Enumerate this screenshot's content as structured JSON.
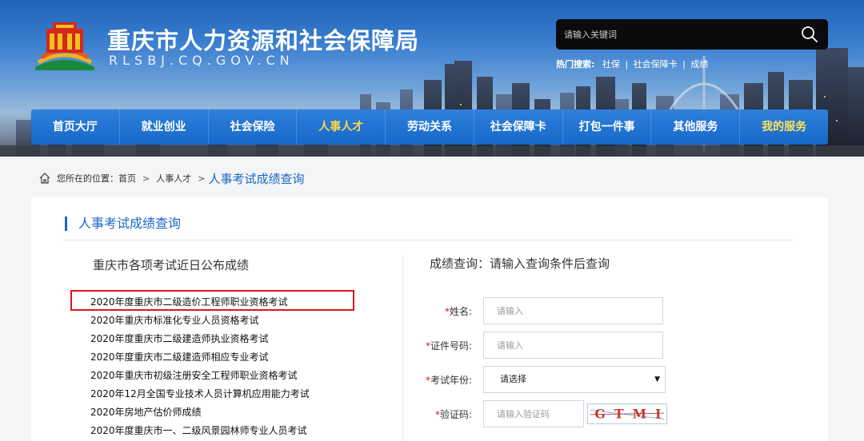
{
  "header": {
    "title": "重庆市人力资源和社会保障局",
    "domain": "RLSBJ.CQ.GOV.CN",
    "search": {
      "placeholder": "请输入关键词",
      "icon": "search-icon"
    },
    "hot_search": {
      "label": "热门搜索:",
      "items": [
        "社保",
        "社会保障卡",
        "成绩"
      ]
    }
  },
  "nav": {
    "items": [
      {
        "label": "首页大厅"
      },
      {
        "label": "就业创业"
      },
      {
        "label": "社会保险"
      },
      {
        "label": "人事人才"
      },
      {
        "label": "劳动关系"
      },
      {
        "label": "社会保障卡"
      },
      {
        "label": "打包一件事"
      },
      {
        "label": "其他服务"
      },
      {
        "label": "我的服务"
      }
    ],
    "active_index": 3
  },
  "breadcrumb": {
    "prefix": "您所在的位置：",
    "items": [
      "首页",
      "人事人才"
    ],
    "current": "人事考试成绩查询"
  },
  "page": {
    "title": "人事考试成绩查询"
  },
  "left": {
    "heading": "重庆市各项考试近日公布成绩",
    "exams": [
      "2020年度重庆市二级造价工程师职业资格考试",
      "2020年重庆市标准化专业人员资格考试",
      "2020年度重庆市二级建造师执业资格考试",
      "2020年度重庆市二级建造师相应专业考试",
      "2020年重庆市初级注册安全工程师职业资格考试",
      "2020年12月全国专业技术人员计算机应用能力考试",
      "2020年房地产估价师成绩",
      "2020年度重庆市一、二级风景园林师专业人员考试"
    ]
  },
  "right": {
    "heading": "成绩查询：请输入查询条件后查询",
    "required_mark": "*",
    "fields": {
      "name": {
        "label": "姓名:",
        "placeholder": "请输入"
      },
      "id_number": {
        "label": "证件号码:",
        "placeholder": "请输入"
      },
      "exam_year": {
        "label": "考试年份:",
        "selected": "请选择"
      },
      "captcha": {
        "label": "验证码:",
        "placeholder": "请输入验证码",
        "image_text": "GTMI"
      }
    }
  },
  "colors": {
    "nav_blue": "#1769c8",
    "accent_blue": "#1a66c7",
    "active_nav": "#ffd84a",
    "highlight_red": "#e0141c"
  }
}
